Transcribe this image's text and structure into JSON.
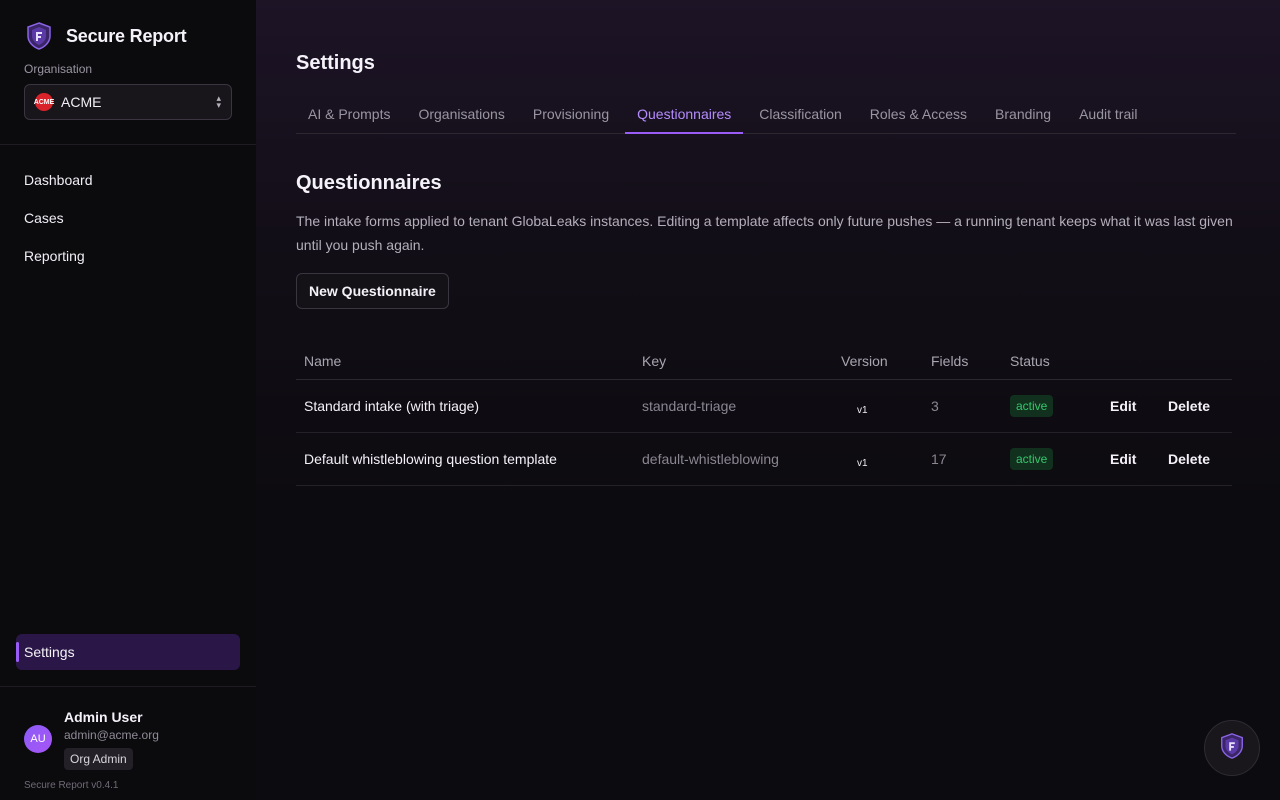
{
  "app": {
    "name": "Secure Report",
    "version": "Secure Report v0.4.1"
  },
  "org": {
    "label": "Organisation",
    "selected": "ACME",
    "logo_text": "ACME"
  },
  "nav": {
    "items": [
      {
        "label": "Dashboard"
      },
      {
        "label": "Cases"
      },
      {
        "label": "Reporting"
      }
    ],
    "settings": "Settings"
  },
  "user": {
    "initials": "AU",
    "name": "Admin User",
    "email": "admin@acme.org",
    "role": "Org Admin"
  },
  "page": {
    "title": "Settings"
  },
  "tabs": [
    {
      "label": "AI & Prompts"
    },
    {
      "label": "Organisations"
    },
    {
      "label": "Provisioning"
    },
    {
      "label": "Questionnaires"
    },
    {
      "label": "Classification"
    },
    {
      "label": "Roles & Access"
    },
    {
      "label": "Branding"
    },
    {
      "label": "Audit trail"
    }
  ],
  "section": {
    "title": "Questionnaires",
    "description": "The intake forms applied to tenant GlobaLeaks instances. Editing a template affects only future pushes — a running tenant keeps what it was last given until you push again.",
    "new_button": "New Questionnaire"
  },
  "table": {
    "headers": {
      "name": "Name",
      "key": "Key",
      "version": "Version",
      "fields": "Fields",
      "status": "Status"
    },
    "rows": [
      {
        "name": "Standard intake (with triage)",
        "key": "standard-triage",
        "version": "v1",
        "fields": "3",
        "status": "active",
        "edit": "Edit",
        "delete": "Delete"
      },
      {
        "name": "Default whistleblowing question template",
        "key": "default-whistleblowing",
        "version": "v1",
        "fields": "17",
        "status": "active",
        "edit": "Edit",
        "delete": "Delete"
      }
    ]
  },
  "colors": {
    "accent": "#9a5cf7",
    "status_active": "#36c76b",
    "org_logo": "#d8232a"
  },
  "icons": {
    "brand": "shield-logo-icon",
    "org_select": "chevrons-up-down-icon",
    "fab": "shield-logo-icon"
  }
}
